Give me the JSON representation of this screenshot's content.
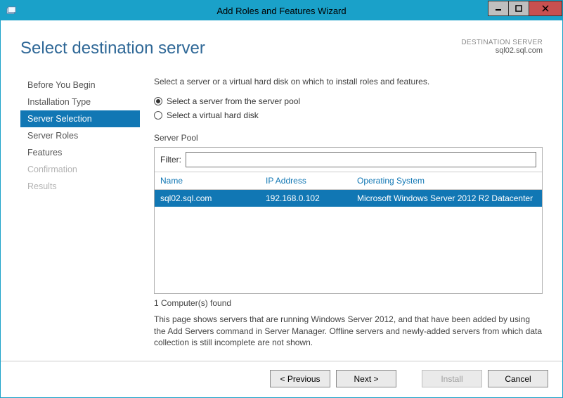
{
  "titlebar": {
    "text": "Add Roles and Features Wizard"
  },
  "header": {
    "page_title": "Select destination server",
    "dest_label": "DESTINATION SERVER",
    "dest_name": "sql02.sql.com"
  },
  "sidebar": {
    "items": [
      {
        "label": "Before You Begin",
        "state": "normal"
      },
      {
        "label": "Installation Type",
        "state": "normal"
      },
      {
        "label": "Server Selection",
        "state": "active"
      },
      {
        "label": "Server Roles",
        "state": "normal"
      },
      {
        "label": "Features",
        "state": "normal"
      },
      {
        "label": "Confirmation",
        "state": "disabled"
      },
      {
        "label": "Results",
        "state": "disabled"
      }
    ]
  },
  "main": {
    "instruction": "Select a server or a virtual hard disk on which to install roles and features.",
    "radios": [
      {
        "label": "Select a server from the server pool",
        "checked": true
      },
      {
        "label": "Select a virtual hard disk",
        "checked": false
      }
    ],
    "section_label": "Server Pool",
    "filter_label": "Filter:",
    "filter_value": "",
    "columns": {
      "name": "Name",
      "ip": "IP Address",
      "os": "Operating System"
    },
    "rows": [
      {
        "name": "sql02.sql.com",
        "ip": "192.168.0.102",
        "os": "Microsoft Windows Server 2012 R2 Datacenter",
        "selected": true
      }
    ],
    "count_text": "1 Computer(s) found",
    "note": "This page shows servers that are running Windows Server 2012, and that have been added by using the Add Servers command in Server Manager. Offline servers and newly-added servers from which data collection is still incomplete are not shown."
  },
  "footer": {
    "previous": "< Previous",
    "next": "Next >",
    "install": "Install",
    "cancel": "Cancel"
  }
}
